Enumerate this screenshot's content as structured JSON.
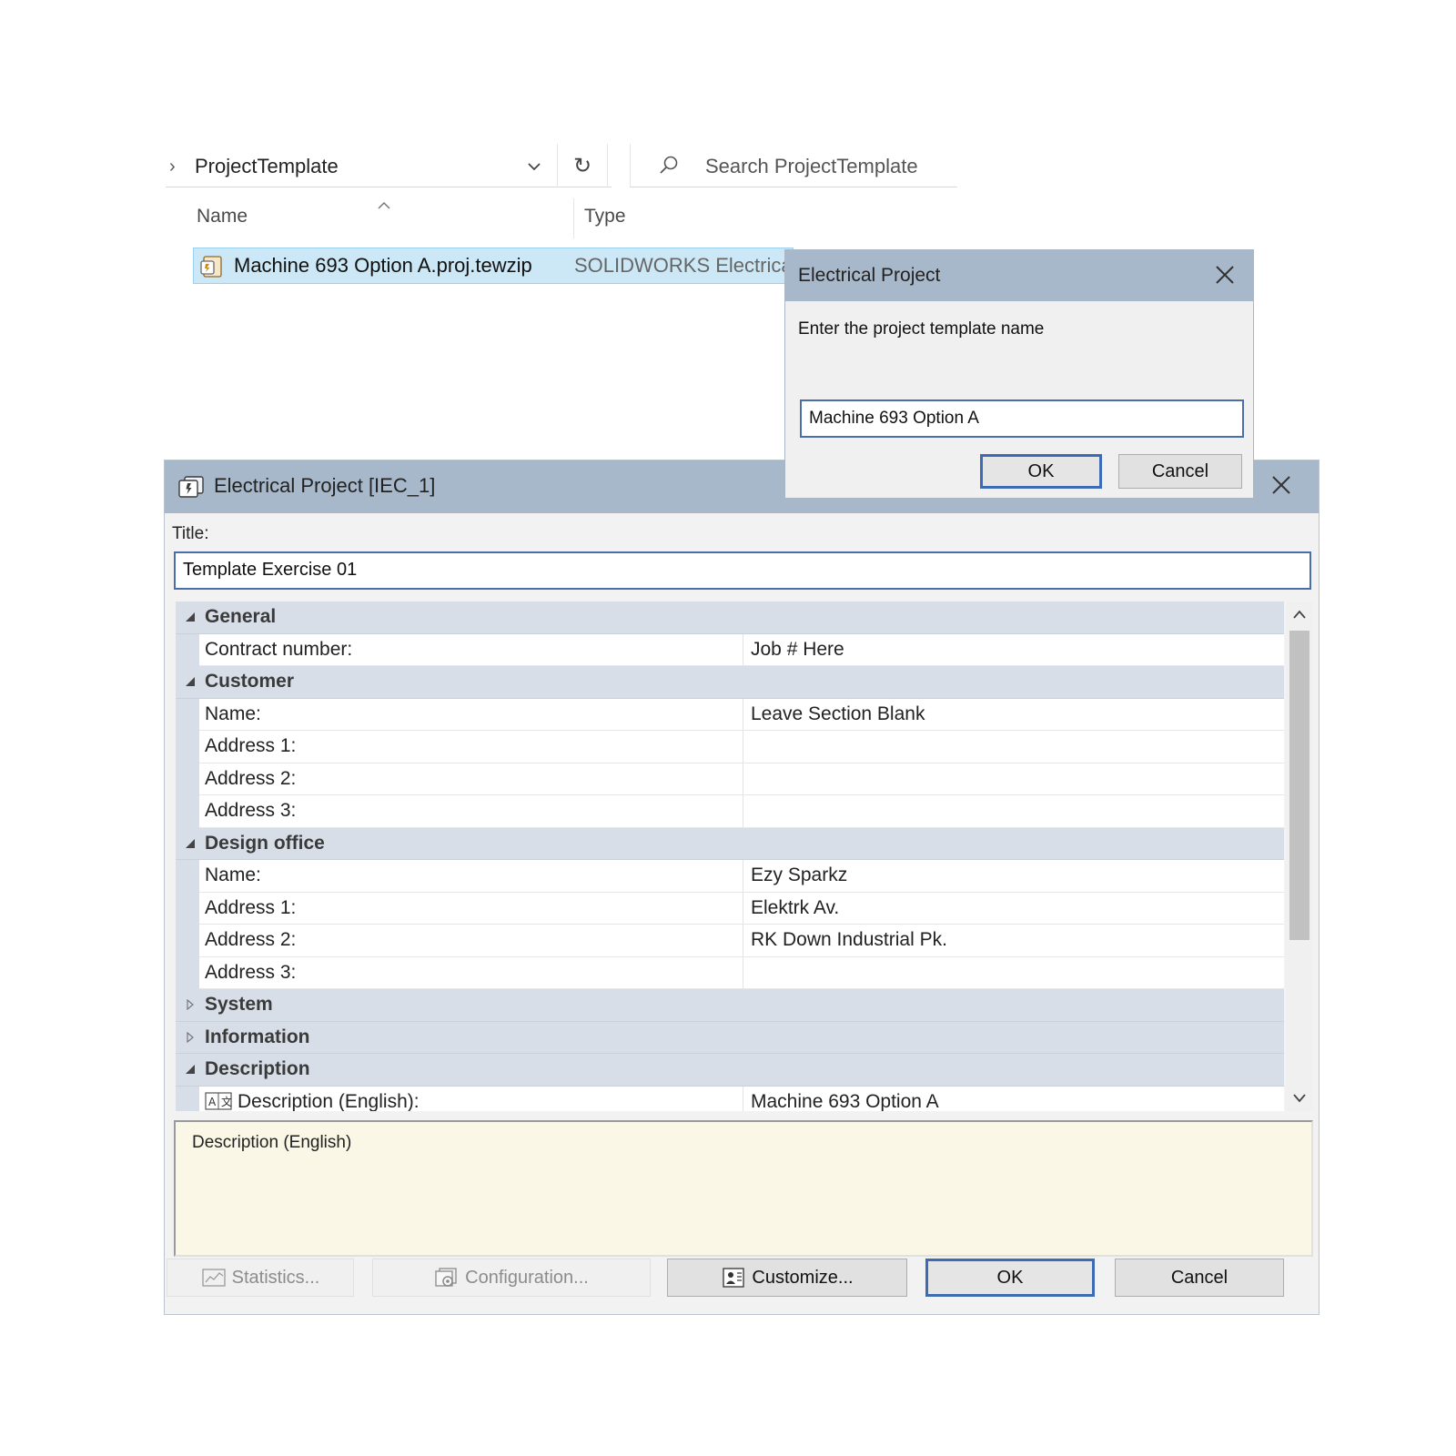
{
  "explorer": {
    "breadcrumb_folder": "ProjectTemplate",
    "search_placeholder": "Search ProjectTemplate",
    "columns": {
      "name": "Name",
      "type": "Type"
    },
    "file": {
      "name": "Machine 693 Option A.proj.tewzip",
      "type": "SOLIDWORKS Electrica"
    }
  },
  "name_dialog": {
    "title": "Electrical Project",
    "prompt": "Enter the project template name",
    "input_value": "Machine 693 Option A",
    "ok_label": "OK",
    "cancel_label": "Cancel"
  },
  "project_dialog": {
    "title": "Electrical Project [IEC_1]",
    "title_field_label": "Title:",
    "title_field_value": "Template Exercise 01",
    "groups": {
      "general": {
        "label": "General",
        "expanded": true,
        "contract_number_label": "Contract number:",
        "contract_number_value": "Job # Here"
      },
      "customer": {
        "label": "Customer",
        "expanded": true,
        "name_label": "Name:",
        "name_value": "Leave Section Blank",
        "address1_label": "Address 1:",
        "address2_label": "Address 2:",
        "address3_label": "Address 3:"
      },
      "design_office": {
        "label": "Design office",
        "expanded": true,
        "name_label": "Name:",
        "name_value": "Ezy Sparkz",
        "address1_label": "Address 1:",
        "address1_value": "Elektrk Av.",
        "address2_label": "Address 2:",
        "address2_value": "RK Down Industrial Pk.",
        "address3_label": "Address 3:"
      },
      "system": {
        "label": "System",
        "expanded": false
      },
      "information": {
        "label": "Information",
        "expanded": false
      },
      "description": {
        "label": "Description",
        "expanded": true,
        "english_label": "Description (English):",
        "english_value": "Machine 693 Option A"
      }
    },
    "description_box_label": "Description (English)",
    "buttons": {
      "statistics": "Statistics...",
      "configuration": "Configuration...",
      "customize": "Customize...",
      "ok": "OK",
      "cancel": "Cancel"
    }
  },
  "colors": {
    "titlebar": "#a8b8cb",
    "group_row": "#d7dee8",
    "selection": "#cce8f6",
    "default_button_border": "#3d6bb3",
    "description_bg": "#fbf7e6"
  },
  "icons": [
    "chevron-right-icon",
    "chevron-down-icon",
    "refresh-icon",
    "search-icon",
    "sort-up-icon",
    "project-archive-icon",
    "close-icon",
    "project-icon",
    "expand-triangle-icon",
    "collapse-triangle-icon",
    "language-icon",
    "scroll-up-icon",
    "scroll-down-icon",
    "statistics-icon",
    "configuration-icon",
    "customize-icon"
  ]
}
